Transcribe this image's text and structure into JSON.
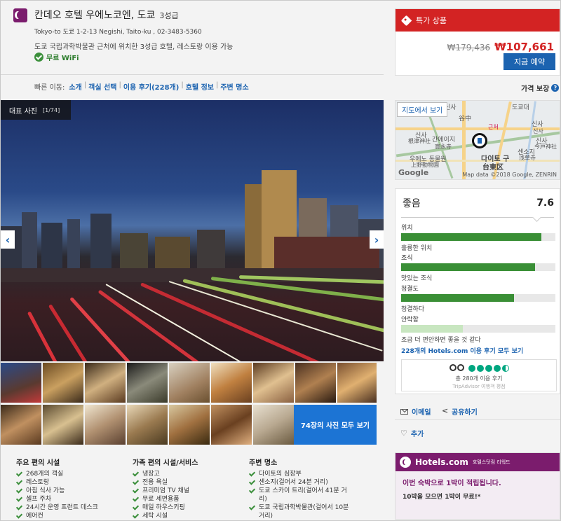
{
  "hotel": {
    "name": "칸데오 호텔 우에노코엔, 도쿄",
    "star_label": "3성급",
    "address": "Tokyo-to 도쿄 1-2-13 Negishi, Taito-ku ,  02-3483-5360",
    "description": "도쿄 국립과학박물관 근처에 위치한 3성급 호텔, 레스토랑 이용 가능",
    "wifi_label": "무료 WiFi"
  },
  "quick_nav": {
    "label": "빠른 이동:",
    "links": [
      "소개",
      "객실 선택",
      "이용 후기(228개)",
      "호텔 정보",
      "주변 명소"
    ]
  },
  "gallery": {
    "badge_label": "대표 사진",
    "badge_count": "[1/74]",
    "prev_icon": "‹",
    "next_icon": "›",
    "view_all_label": "74장의 사진 모두 보기"
  },
  "amenities": {
    "main": {
      "title": "주요 편의 시설",
      "items": [
        "268개의 객실",
        "레스토랑",
        "아침 식사 가능",
        "셀프 주차",
        "24시간 운영 프런트 데스크",
        "에어컨"
      ]
    },
    "family": {
      "title": "가족 편의 시설/서비스",
      "items": [
        "냉장고",
        "전용 욕실",
        "프리미엄 TV 채널",
        "무료 세면용품",
        "매일 하우스키핑",
        "세탁 시설"
      ]
    },
    "nearby": {
      "title": "주변 명소",
      "items": [
        "다이토의 심장부",
        "센소지(걸어서 24분 거리)",
        "도쿄 스카이 트리(걸어서 41분 거리)",
        "도쿄 국립과학박물관(걸어서 10분 거리)"
      ]
    }
  },
  "deal": {
    "title": "특가 상품",
    "old_price": "₩179,436",
    "new_price": "₩107,661",
    "book_label": "지금 예약",
    "guarantee_label": "가격 보장",
    "guarantee_icon": "?"
  },
  "map": {
    "button_label": "지도에서 보기",
    "labels": [
      "신사",
      "谷中",
      "간에이지",
      "寛永寺",
      "신사",
      "근처",
      "신사",
      "根津神社",
      "우에노 동물원",
      "上野動物園",
      "다이토 구",
      "台東区",
      "신사",
      "今戸神社",
      "센소지",
      "浅草寺",
      "신사",
      "도쿄대"
    ],
    "google_label": "Google",
    "copyright": "Map data ©2018 Google, ZENRIN"
  },
  "review": {
    "rating_word": "좋음",
    "score": "7.6",
    "items": [
      {
        "category": "위치",
        "description": "훌륭한 위치",
        "value": 0.91
      },
      {
        "category": "조식",
        "description": "맛있는 조식",
        "value": 0.87
      },
      {
        "category": "청결도",
        "description": "청결하다",
        "value": 0.73
      },
      {
        "category": "안락함",
        "description": "조금 더 편안하면 좋을 것 같다",
        "value": 0.4
      }
    ],
    "all_reviews_label": "228개의 Hotels.com 이용 후기 모두 보기",
    "tripadvisor": {
      "rating": 4.5,
      "count_label": "총 280개 이용 후기",
      "source_label": "TripAdvisor 여행객 평점"
    }
  },
  "share": {
    "email_label": "이메일",
    "share_label": "공유하기",
    "add_label": "추가",
    "heart_icon": "♡"
  },
  "rewards": {
    "brand": "Hotels.com",
    "sub": "호텔스닷컴 리워드",
    "line1": "이번 숙박으로 1박이 적립됩니다.",
    "line2": "10박을 모으면 1박이 무료!*"
  },
  "colors": {
    "accent": "#1c63b0",
    "deal_red": "#d32323",
    "brand_purple": "#7b1c6d",
    "bar_green": "#3a8f36",
    "bar_light_green": "#c8e6c0"
  }
}
